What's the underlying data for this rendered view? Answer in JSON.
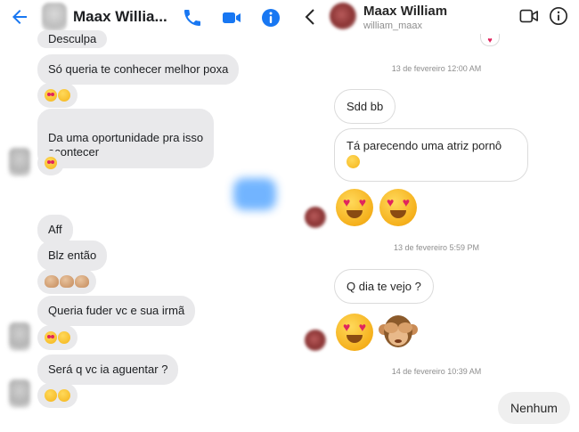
{
  "left": {
    "contact_name": "Maax Willia...",
    "messages": [
      {
        "text": "Desculpa"
      },
      {
        "text": "Só queria te conhecer melhor poxa"
      },
      {
        "text": "Da uma oportunidade pra isso\nacontecer"
      },
      {
        "text": "Aff"
      },
      {
        "text": "Blz então"
      },
      {
        "text": "Queria fuder vc e sua irmã"
      },
      {
        "text": "Será q vc ia aguentar ?"
      }
    ],
    "icons": [
      "back-arrow-icon",
      "phone-icon",
      "video-icon",
      "info-icon"
    ]
  },
  "right": {
    "contact_name": "Maax William",
    "username": "william_maax",
    "timestamps": [
      "13 de fevereiro 12:00 AM",
      "13 de fevereiro 5:59 PM",
      "14 de fevereiro 10:39 AM"
    ],
    "messages": [
      {
        "text": "Sdd bb"
      },
      {
        "text": "Tá parecendo uma atriz pornô"
      },
      {
        "text": "Q dia te vejo ?"
      }
    ],
    "my_message": "Nenhum",
    "icons": [
      "back-chevron-icon",
      "video-icon",
      "info-icon"
    ]
  }
}
